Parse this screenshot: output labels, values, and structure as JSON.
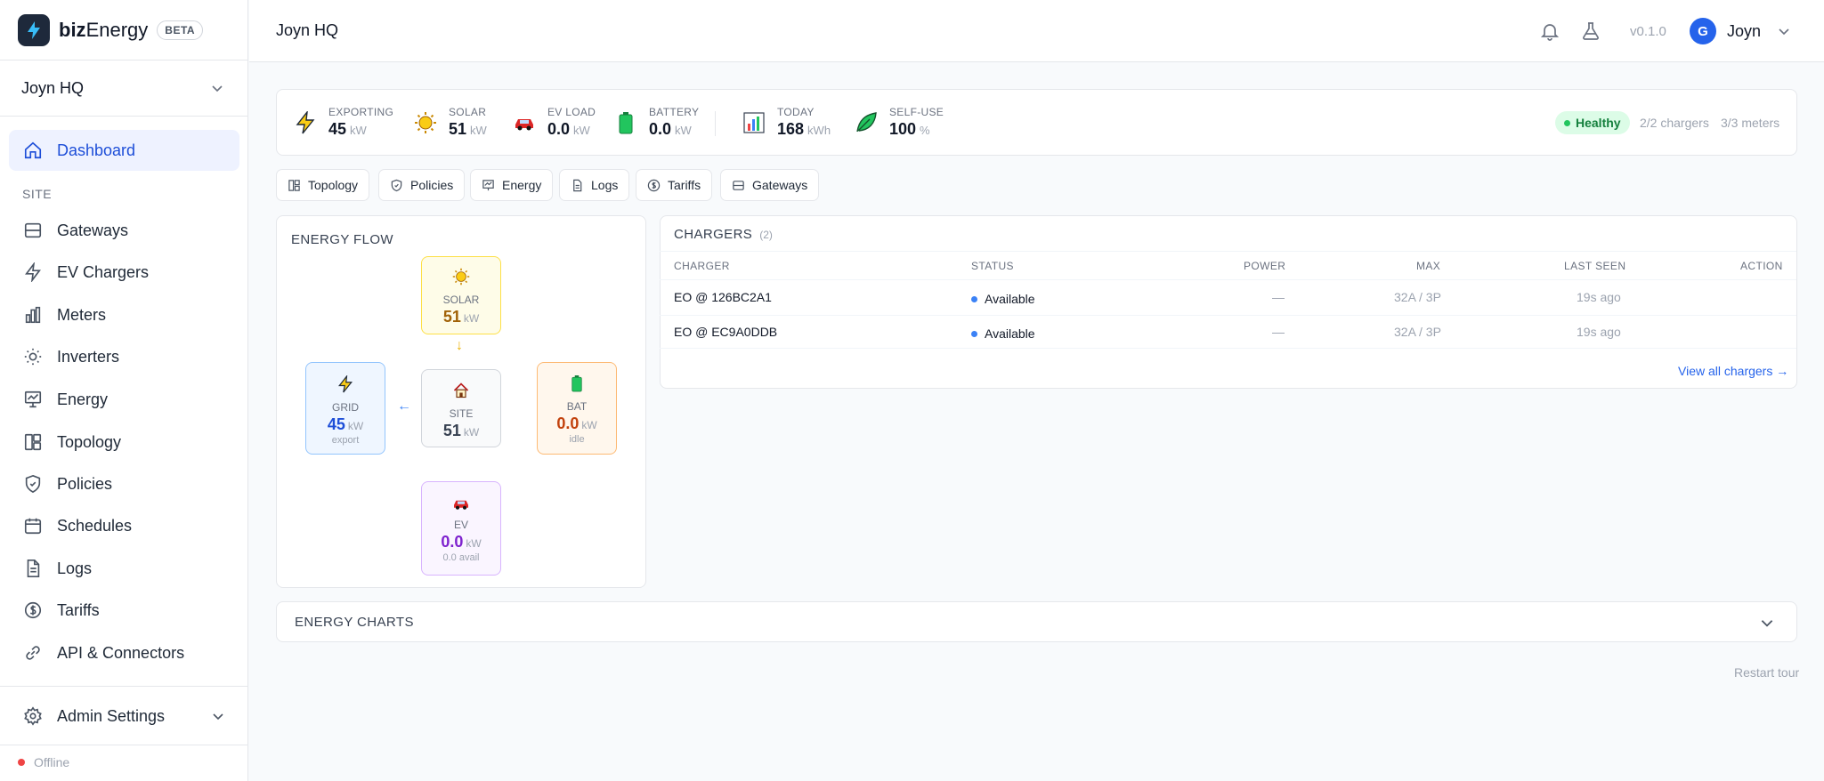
{
  "app": {
    "name_prefix": "biz",
    "name_suffix": "Energy",
    "badge": "BETA"
  },
  "site_selector": {
    "value": "Joyn HQ"
  },
  "sidebar": {
    "section_label": "SITE",
    "items": [
      {
        "label": "Dashboard",
        "icon": "home-icon"
      },
      {
        "label": "Gateways",
        "icon": "gateway-icon"
      },
      {
        "label": "EV Chargers",
        "icon": "bolt-icon"
      },
      {
        "label": "Meters",
        "icon": "bar-chart-icon"
      },
      {
        "label": "Inverters",
        "icon": "sun-icon"
      },
      {
        "label": "Energy",
        "icon": "presentation-chart-icon"
      },
      {
        "label": "Topology",
        "icon": "topology-icon"
      },
      {
        "label": "Policies",
        "icon": "shield-icon"
      },
      {
        "label": "Schedules",
        "icon": "calendar-icon"
      },
      {
        "label": "Logs",
        "icon": "document-icon"
      },
      {
        "label": "Tariffs",
        "icon": "dollar-icon"
      },
      {
        "label": "API & Connectors",
        "icon": "link-icon"
      }
    ],
    "admin_label": "Admin Settings",
    "connection_status": "Offline"
  },
  "header": {
    "title": "Joyn HQ",
    "version": "v0.1.0",
    "user_initial": "G",
    "user_name": "Joyn"
  },
  "stats": {
    "exporting": {
      "label": "EXPORTING",
      "value": "45",
      "unit": "kW"
    },
    "solar": {
      "label": "SOLAR",
      "value": "51",
      "unit": "kW"
    },
    "ev_load": {
      "label": "EV LOAD",
      "value": "0.0",
      "unit": "kW"
    },
    "battery": {
      "label": "BATTERY",
      "value": "0.0",
      "unit": "kW"
    },
    "today": {
      "label": "TODAY",
      "value": "168",
      "unit": "kWh"
    },
    "self_use": {
      "label": "SELF-USE",
      "value": "100",
      "unit": "%"
    },
    "health": "Healthy",
    "chargers_count": "2/2 chargers",
    "meters_count": "3/3 meters"
  },
  "tabs": [
    "Topology",
    "Policies",
    "Energy",
    "Logs",
    "Tariffs",
    "Gateways"
  ],
  "energy_flow": {
    "title": "ENERGY FLOW",
    "solar": {
      "label": "SOLAR",
      "value": "51",
      "unit": "kW"
    },
    "grid": {
      "label": "GRID",
      "value": "45",
      "unit": "kW",
      "sub": "export"
    },
    "site": {
      "label": "SITE",
      "value": "51",
      "unit": "kW"
    },
    "battery": {
      "label": "BAT",
      "value": "0.0",
      "unit": "kW",
      "sub": "idle"
    },
    "ev": {
      "label": "EV",
      "value": "0.0",
      "unit": "kW",
      "sub": "0.0 avail"
    },
    "arrow_down": "↓",
    "arrow_left": "←"
  },
  "chargers": {
    "title": "CHARGERS",
    "count": "(2)",
    "columns": [
      "CHARGER",
      "STATUS",
      "POWER",
      "MAX",
      "LAST SEEN",
      "ACTION"
    ],
    "rows": [
      {
        "name": "EO @ 126BC2A1",
        "status": "Available",
        "power": "—",
        "max": "32A / 3P",
        "last_seen": "19s ago"
      },
      {
        "name": "EO @ EC9A0DDB",
        "status": "Available",
        "power": "—",
        "max": "32A / 3P",
        "last_seen": "19s ago"
      }
    ],
    "view_all": "View all chargers →"
  },
  "energy_charts": {
    "title": "ENERGY CHARTS"
  },
  "footer": {
    "restart_tour": "Restart tour"
  },
  "colors": {
    "accent": "#2563eb",
    "active_bg": "#eef2ff",
    "healthy_bg": "#dcfce7",
    "offline": "#ef4444"
  }
}
